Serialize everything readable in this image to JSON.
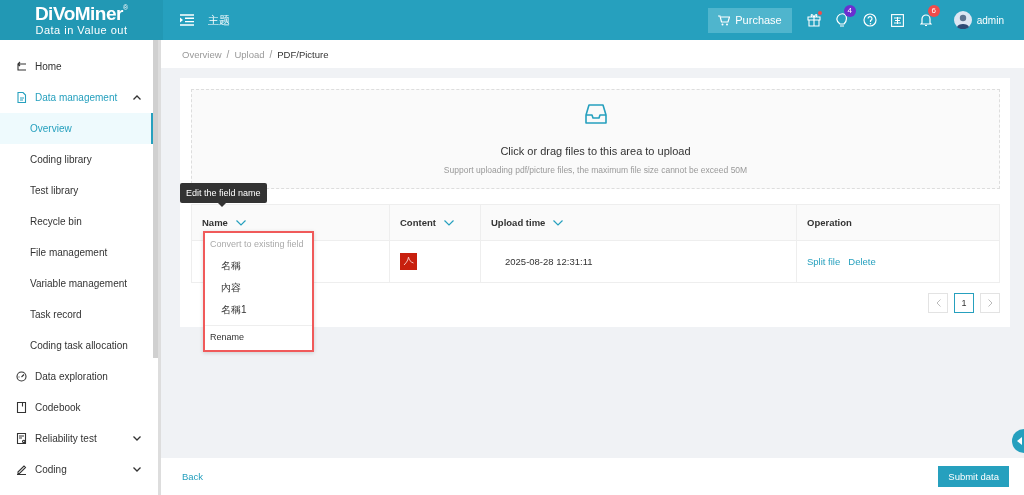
{
  "header": {
    "logo": "DiVoMiner",
    "registered": "®",
    "slogan": "Data in  Value out",
    "theme": "主题",
    "purchase": "Purchase",
    "badges": [
      {
        "kind": "gift"
      },
      {
        "kind": "bulb",
        "count": "4"
      },
      {
        "kind": "help"
      },
      {
        "kind": "lang"
      },
      {
        "kind": "bell",
        "count": "6"
      }
    ],
    "user": "admin"
  },
  "sidebar": {
    "items": [
      {
        "label": "Home",
        "selected": false
      },
      {
        "label": "Data management",
        "expanded": true,
        "selected": true,
        "children": [
          {
            "label": "Overview",
            "selected": true
          },
          {
            "label": "Coding library",
            "selected": false
          },
          {
            "label": "Test library",
            "selected": false
          },
          {
            "label": "Recycle bin",
            "selected": false
          },
          {
            "label": "File management",
            "selected": false
          },
          {
            "label": "Variable management",
            "selected": false
          },
          {
            "label": "Task record",
            "selected": false
          },
          {
            "label": "Coding task allocation",
            "selected": false
          }
        ]
      },
      {
        "label": "Data exploration",
        "selected": false
      },
      {
        "label": "Codebook",
        "selected": false
      },
      {
        "label": "Reliability test",
        "expanded": false,
        "selected": false
      },
      {
        "label": "Coding",
        "expanded": false,
        "selected": false
      }
    ]
  },
  "breadcrumb": [
    {
      "label": "Overview",
      "separator": "/"
    },
    {
      "label": "Upload",
      "separator": "/"
    },
    {
      "label": "PDF/Picture"
    }
  ],
  "upload": {
    "title": "Click or drag files to this area to upload",
    "hint": "Support uploading pdf/picture files, the maximum file size cannot be exceed 50M"
  },
  "tooltip": "Edit the field name",
  "table": {
    "columns": [
      {
        "label": "Name",
        "filter": true
      },
      {
        "label": "Content",
        "filter": true
      },
      {
        "label": "Upload time",
        "filter": true
      },
      {
        "label": "Operation",
        "filter": false
      }
    ],
    "rows": [
      {
        "time": "2025-08-28 12:31:11",
        "actions": [
          "Split file",
          "Delete"
        ]
      }
    ]
  },
  "dropdown": {
    "header": "Convert to existing field",
    "items": [
      "名稱",
      "內容",
      "名稱1"
    ],
    "footer": "Rename"
  },
  "pagination": {
    "pages": [
      {
        "label": "1",
        "selected": true
      }
    ]
  },
  "footer": {
    "back": "Back",
    "submit": "Submit data"
  }
}
